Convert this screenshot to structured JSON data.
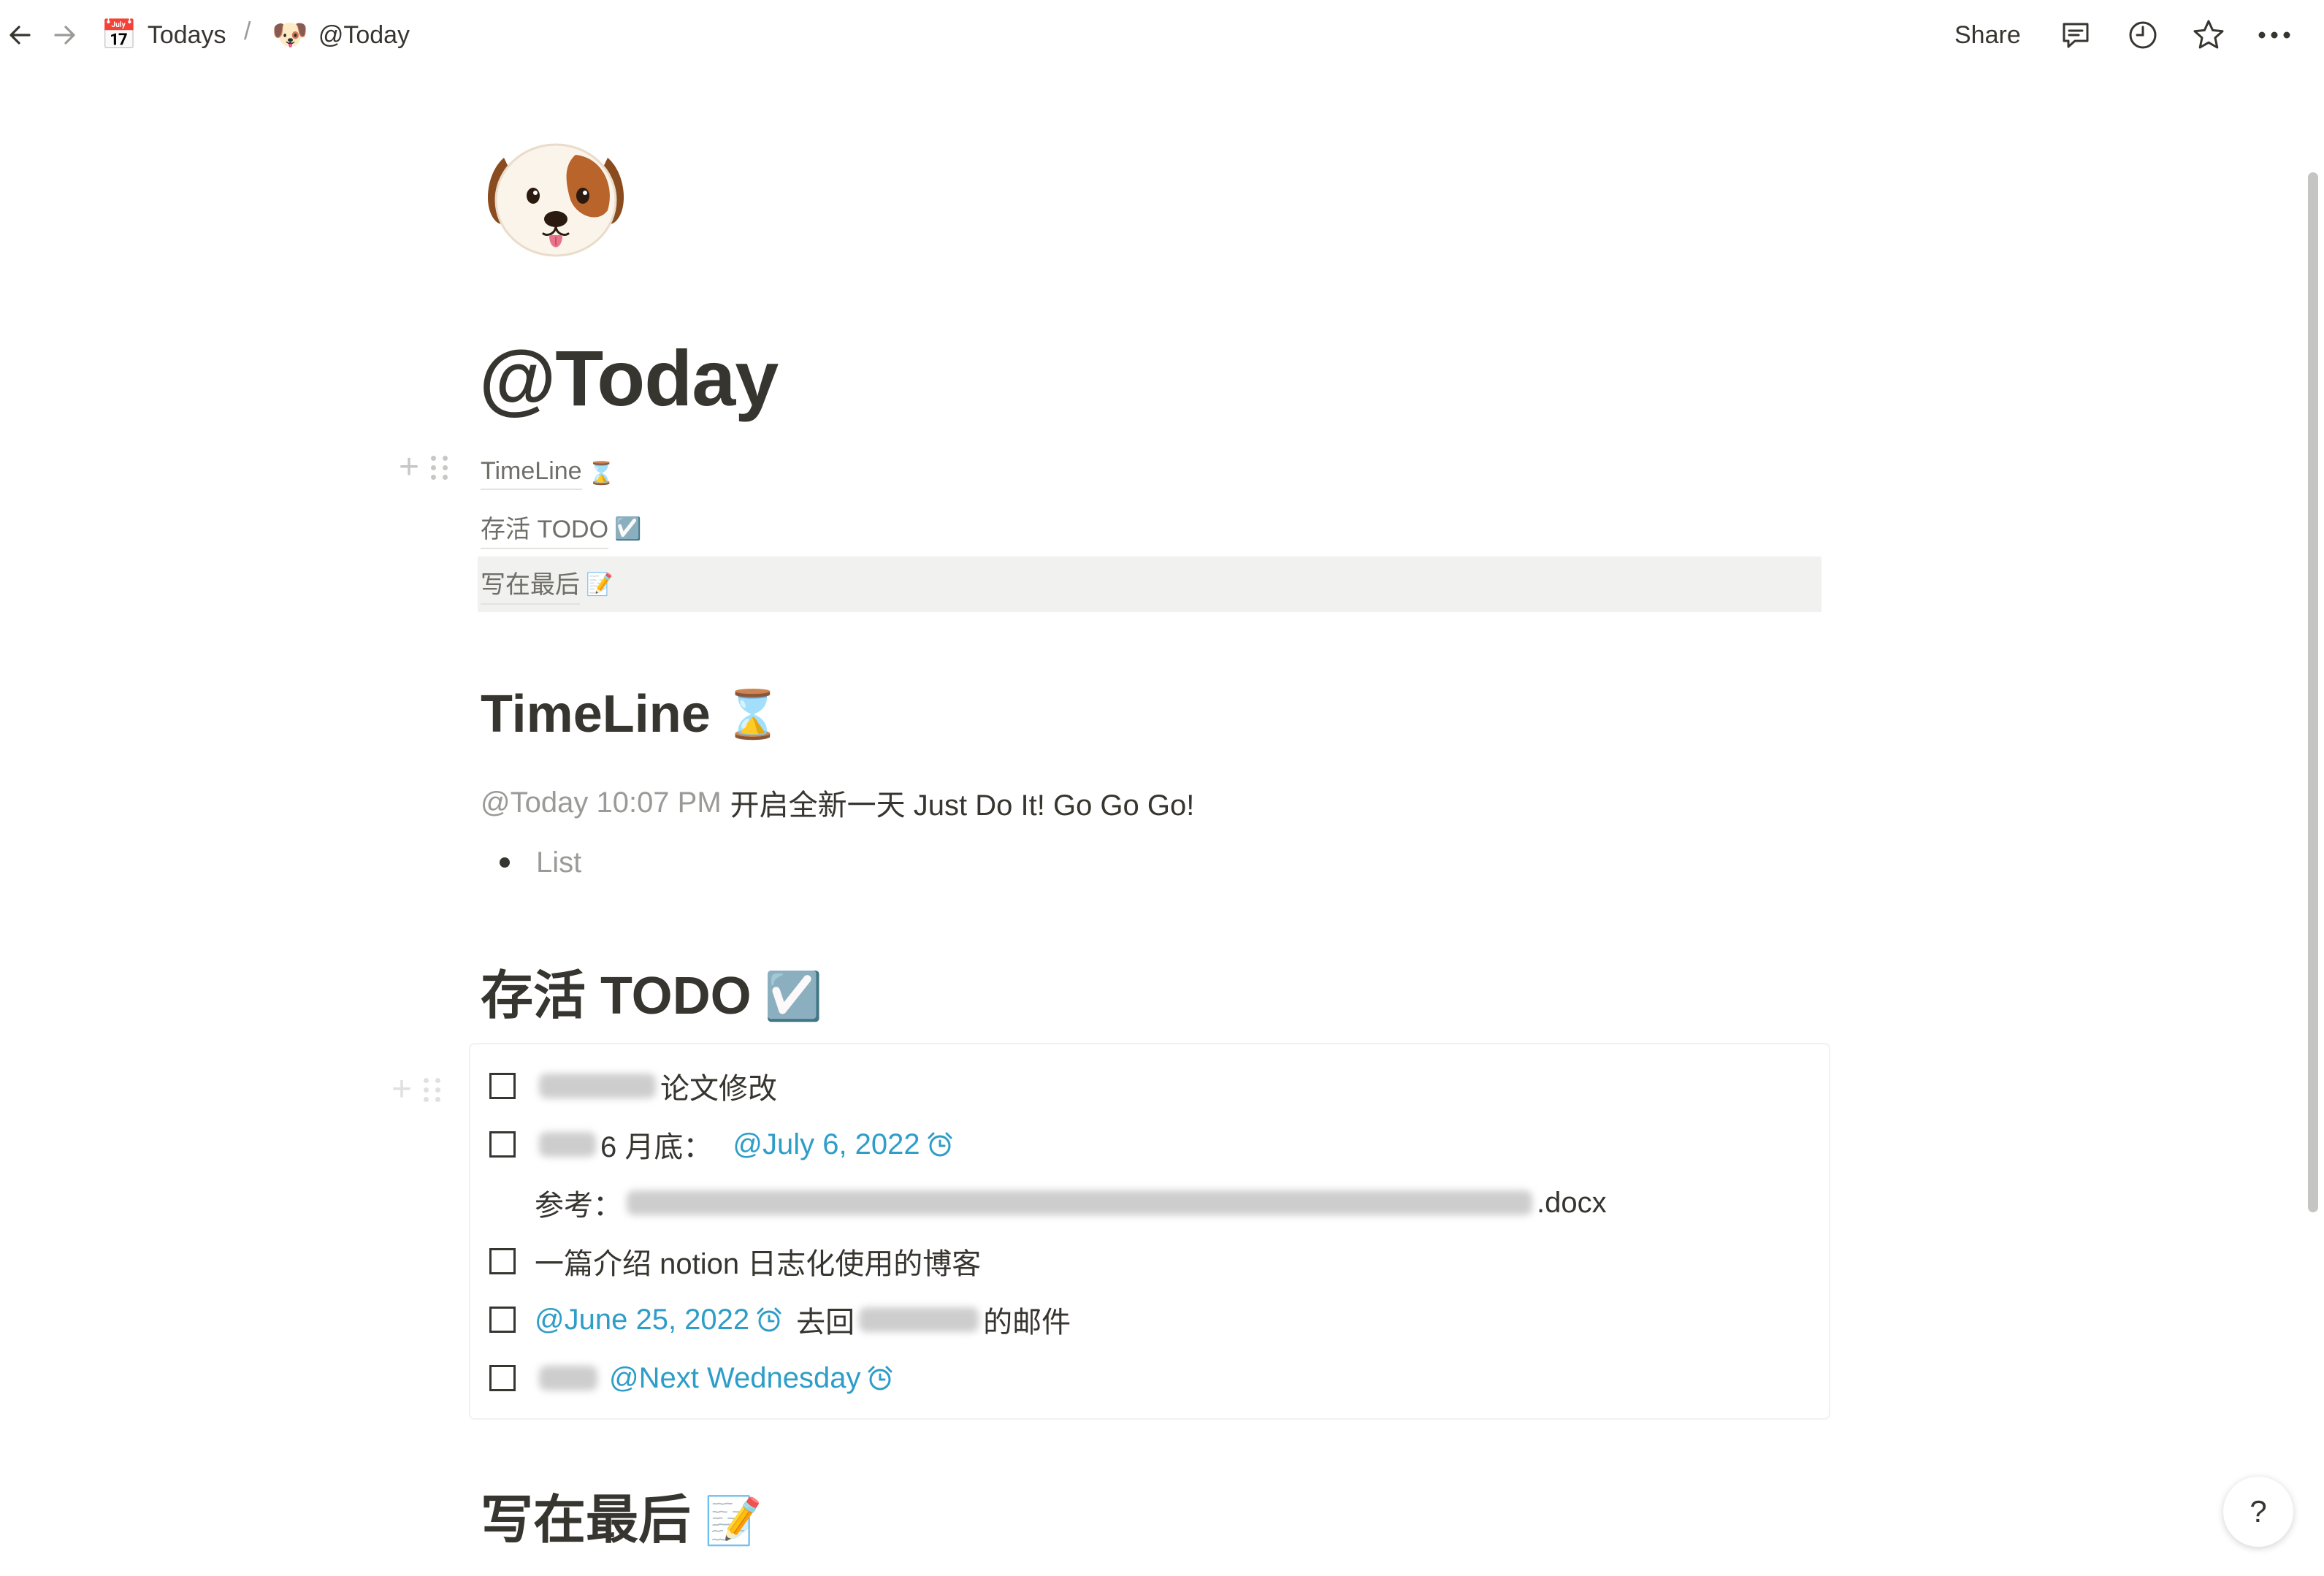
{
  "breadcrumb": {
    "items": [
      {
        "emoji": "📅",
        "label": "Todays"
      },
      {
        "emoji": "🐶",
        "label": "@Today"
      }
    ],
    "separator": "/"
  },
  "topbar": {
    "share_label": "Share",
    "icons": [
      "back-arrow-icon",
      "forward-arrow-icon",
      "comment-icon",
      "clock-icon",
      "star-icon",
      "more-icon"
    ]
  },
  "page": {
    "icon": "dog-face",
    "title": "@Today"
  },
  "toc": [
    {
      "label": "TimeLine",
      "emoji": "⌛"
    },
    {
      "label": "存活 TODO",
      "emoji": "☑️"
    },
    {
      "label": "写在最后",
      "emoji": "📝"
    }
  ],
  "timeline": {
    "heading": "TimeLine",
    "emoji": "⌛",
    "entry_time": "@Today 10:07 PM",
    "entry_text": "开启全新一天 Just Do It! Go Go Go!",
    "bullet_placeholder": "List"
  },
  "todo": {
    "heading": "存活 TODO",
    "emoji": "☑️",
    "items": [
      {
        "text": "论文修改"
      },
      {
        "text": "6 月底：",
        "date": "@July 6, 2022"
      },
      {
        "ref_label": "参考：",
        "ref_suffix": ".docx"
      },
      {
        "text": "一篇介绍 notion 日志化使用的博客"
      },
      {
        "date": "@June 25, 2022",
        "text_before": "去回",
        "text_after": "的邮件"
      },
      {
        "date": "@Next Wednesday"
      }
    ]
  },
  "closing": {
    "heading": "写在最后",
    "emoji": "📝"
  },
  "help_label": "?",
  "colors": {
    "text": "#37352f",
    "muted": "#9b9a97",
    "mention": "#2e9dc8",
    "hover_bg": "#f1f1ef"
  }
}
